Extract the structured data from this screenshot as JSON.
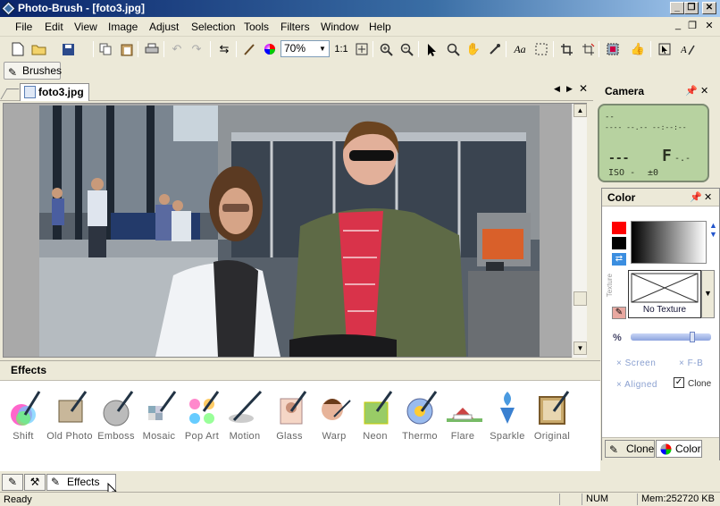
{
  "window": {
    "title": "Photo-Brush - [foto3.jpg]",
    "min": "_",
    "max": "❐",
    "close": "✕"
  },
  "menu": [
    "File",
    "Edit",
    "View",
    "Image",
    "Adjust",
    "Selection",
    "Tools",
    "Filters",
    "Window",
    "Help"
  ],
  "mdi": {
    "min": "_",
    "restore": "❐",
    "close": "✕"
  },
  "toolbar": {
    "zoom": "70%",
    "ratio": "1:1",
    "text_tool": "Aa"
  },
  "brushes_label": "Brushes",
  "document": {
    "tab": "foto3.jpg"
  },
  "camera": {
    "title": "Camera",
    "line1": "--",
    "line2": "---- --.-- --:--:--",
    "shutter": "---",
    "aperture": "F",
    "aperture_val": "-.-",
    "iso": "ISO -",
    "ev": "±0"
  },
  "color": {
    "title": "Color",
    "texture_caption": "No Texture",
    "texture_side": "Texture",
    "percent": "%",
    "screen": "Screen",
    "fb": "F-B",
    "aligned": "Aligned",
    "clone": "Clone",
    "tab_clone": "Clone",
    "tab_color": "Color",
    "fg": "#ff0000",
    "bg": "#000000"
  },
  "effects": {
    "title": "Effects",
    "items": [
      "Shift",
      "Old Photo",
      "Emboss",
      "Mosaic",
      "Pop Art",
      "Motion",
      "Glass",
      "Warp",
      "Neon",
      "Thermo",
      "Flare",
      "Sparkle",
      "Original"
    ]
  },
  "bottom_tabs": {
    "effects": "Effects"
  },
  "status": {
    "left": "Ready",
    "num": "NUM",
    "mem": "Mem:252720 KB"
  }
}
